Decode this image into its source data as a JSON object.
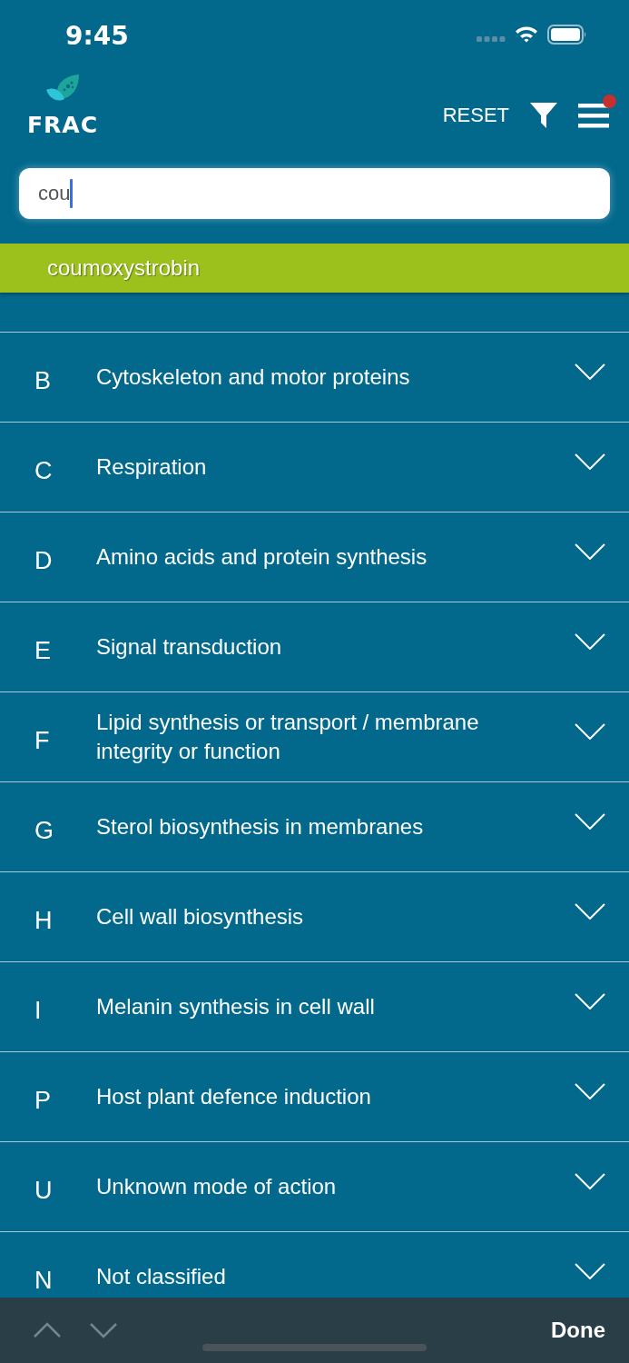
{
  "status_bar": {
    "time": "9:45"
  },
  "header": {
    "logo_text": "FRAC",
    "reset": "RESET",
    "menu_badge": true
  },
  "search": {
    "value": "cou"
  },
  "suggestions": [
    {
      "label": "coumoxystrobin"
    }
  ],
  "groups": [
    {
      "code": "B",
      "name": "Cytoskeleton and motor proteins",
      "expanded": false
    },
    {
      "code": "C",
      "name": "Respiration",
      "expanded": false
    },
    {
      "code": "D",
      "name": "Amino acids and protein synthesis",
      "expanded": false
    },
    {
      "code": "E",
      "name": "Signal transduction",
      "expanded": false
    },
    {
      "code": "F",
      "name": "Lipid synthesis or transport / membrane integrity or function",
      "expanded": false
    },
    {
      "code": "G",
      "name": "Sterol biosynthesis in membranes",
      "expanded": false
    },
    {
      "code": "H",
      "name": "Cell wall biosynthesis",
      "expanded": false
    },
    {
      "code": "I",
      "name": "Melanin synthesis in cell wall",
      "expanded": false
    },
    {
      "code": "P",
      "name": "Host plant defence induction",
      "expanded": false
    },
    {
      "code": "U",
      "name": "Unknown mode of action",
      "expanded": false
    },
    {
      "code": "N",
      "name": "Not classified",
      "expanded": false
    }
  ],
  "keyboard_toolbar": {
    "done": "Done"
  }
}
